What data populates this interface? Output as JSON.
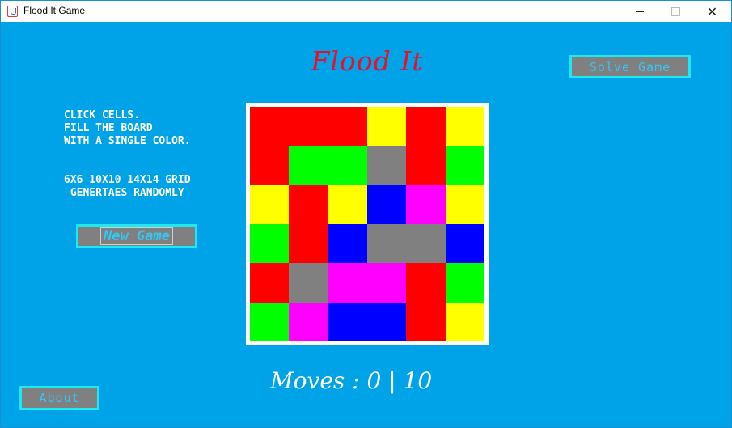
{
  "window": {
    "title": "Flood It Game",
    "controls": {
      "minimize": "",
      "maximize": "",
      "close": "✕"
    }
  },
  "header": {
    "title": "Flood It",
    "solve_label": "Solve Game"
  },
  "instructions": {
    "text": "CLICK CELLS.\nFILL THE BOARD\nWITH A SINGLE COLOR.",
    "grid_info": "6X6 10X10 14X14 GRID\n GENERTAES RANDOMLY"
  },
  "controls": {
    "new_game_label": "New Game",
    "about_label": "About"
  },
  "colors": {
    "background": "#00a2e8",
    "red": "#ff0000",
    "yellow": "#ffff00",
    "green": "#00ff00",
    "gray": "#808080",
    "blue": "#0000ff",
    "magenta": "#ff00ff",
    "button_border": "#1de9f0",
    "button_text": "#33c7f5",
    "title_color": "#e8102a"
  },
  "board": {
    "size": 6,
    "cells": [
      [
        "red",
        "red",
        "red",
        "yellow",
        "red",
        "yellow"
      ],
      [
        "red",
        "green",
        "green",
        "gray",
        "red",
        "green"
      ],
      [
        "yellow",
        "red",
        "yellow",
        "blue",
        "magenta",
        "yellow"
      ],
      [
        "green",
        "red",
        "blue",
        "gray",
        "gray",
        "blue"
      ],
      [
        "red",
        "gray",
        "magenta",
        "magenta",
        "red",
        "green"
      ],
      [
        "green",
        "magenta",
        "blue",
        "blue",
        "red",
        "yellow"
      ]
    ]
  },
  "status": {
    "moves_label": "Moves : ",
    "moves": "0",
    "separator": " | ",
    "max_moves": "10"
  }
}
